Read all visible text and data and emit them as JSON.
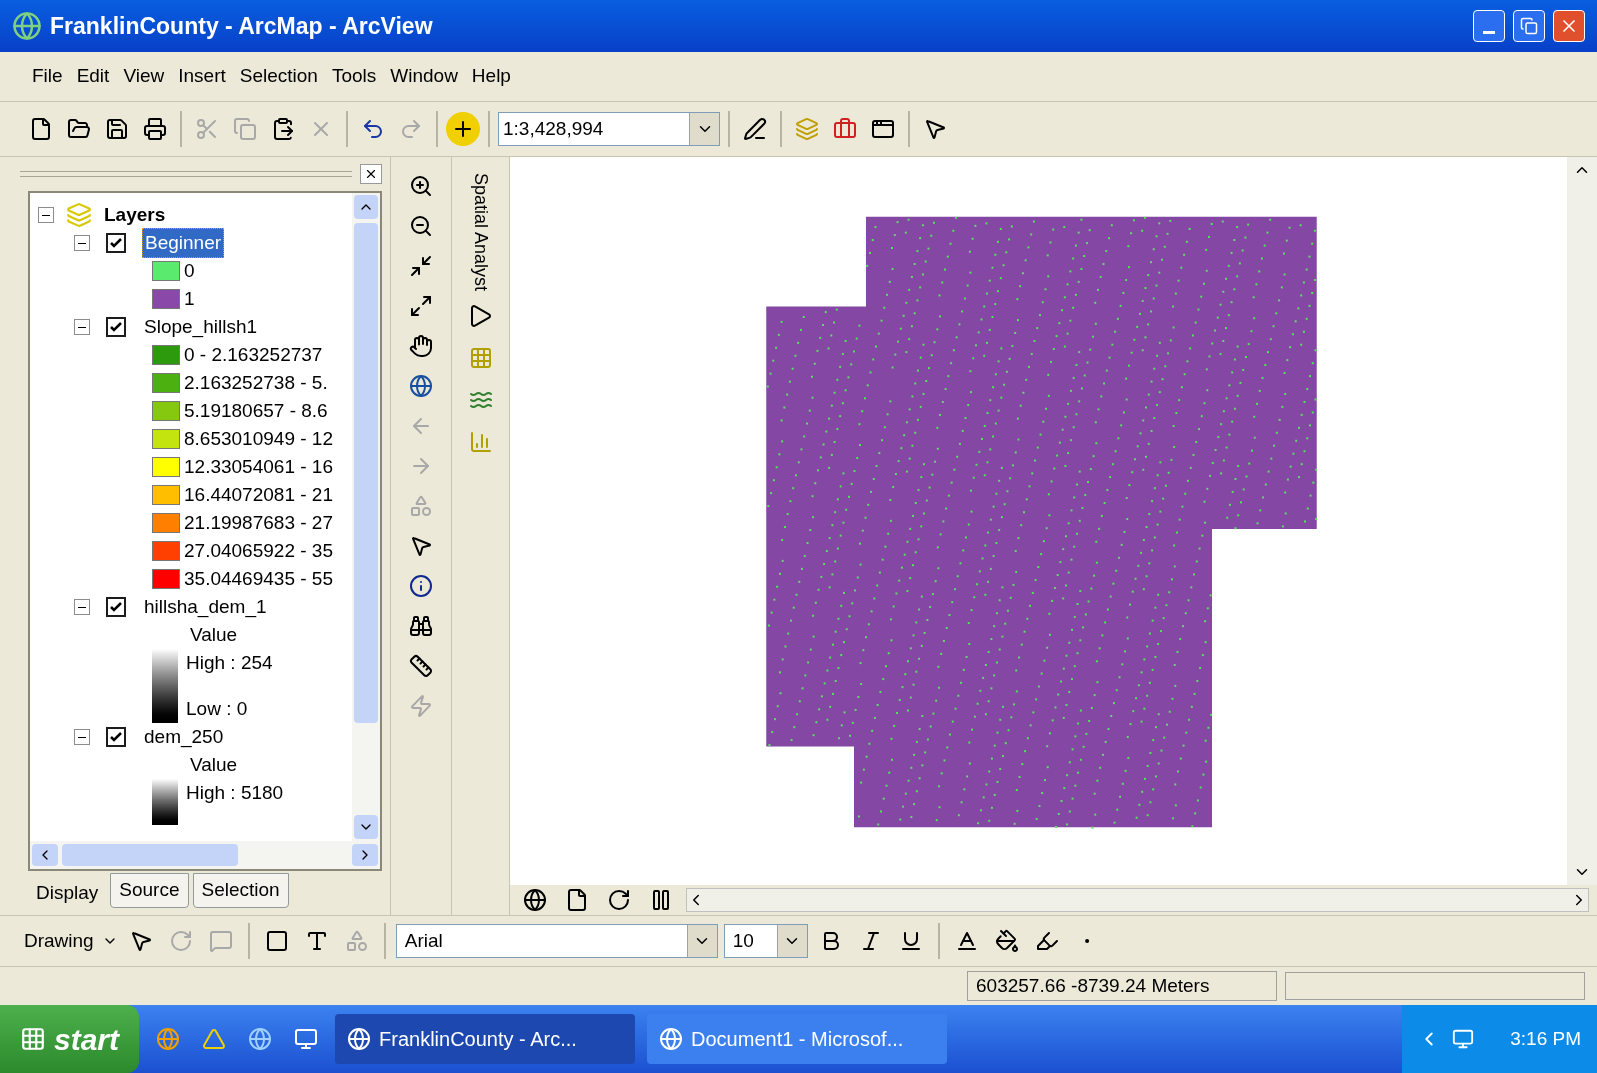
{
  "window": {
    "title": "FranklinCounty - ArcMap - ArcView"
  },
  "menu": [
    "File",
    "Edit",
    "View",
    "Insert",
    "Selection",
    "Tools",
    "Window",
    "Help"
  ],
  "toolbar": {
    "scale": "1:3,428,994"
  },
  "toc": {
    "root": "Layers",
    "layers": [
      {
        "name": "Beginner",
        "checked": true,
        "selected": true,
        "legend": [
          {
            "kind": "swatch",
            "label": "0",
            "color": "#5aea6e"
          },
          {
            "kind": "swatch",
            "label": "1",
            "color": "#8a48a8"
          }
        ]
      },
      {
        "name": "Slope_hillsh1",
        "checked": true,
        "selected": false,
        "legend": [
          {
            "kind": "swatch",
            "label": "0 - 2.163252737",
            "color": "#2c9a0c"
          },
          {
            "kind": "swatch",
            "label": "2.163252738 - 5.",
            "color": "#4cb010"
          },
          {
            "kind": "swatch",
            "label": "5.19180657 - 8.6",
            "color": "#86c810"
          },
          {
            "kind": "swatch",
            "label": "8.653010949 - 12",
            "color": "#c4e410"
          },
          {
            "kind": "swatch",
            "label": "12.33054061 - 16",
            "color": "#ffff00"
          },
          {
            "kind": "swatch",
            "label": "16.44072081 - 21",
            "color": "#ffbf00"
          },
          {
            "kind": "swatch",
            "label": "21.19987683 - 27",
            "color": "#ff8000"
          },
          {
            "kind": "swatch",
            "label": "27.04065922 - 35",
            "color": "#ff4000"
          },
          {
            "kind": "swatch",
            "label": "35.04469435 - 55",
            "color": "#ff0000"
          }
        ]
      },
      {
        "name": "hillsha_dem_1",
        "checked": true,
        "selected": false,
        "legend": [
          {
            "kind": "ramp",
            "heading": "Value",
            "high": "High : 254",
            "low": "Low : 0"
          }
        ]
      },
      {
        "name": "dem_250",
        "checked": true,
        "selected": false,
        "legend": [
          {
            "kind": "ramp",
            "heading": "Value",
            "high": "High : 5180"
          }
        ]
      }
    ]
  },
  "toc_tabs": [
    {
      "label": "Display",
      "selected": true
    },
    {
      "label": "Source",
      "selected": false
    },
    {
      "label": "Selection",
      "selected": false
    }
  ],
  "spatial_analyst": {
    "title": "Spatial Analyst"
  },
  "drawing_toolbar": {
    "menu": "Drawing",
    "font": "Arial",
    "size": "10"
  },
  "status_bar": {
    "coordinates": "603257.66  -8739.24 Meters"
  },
  "taskbar": {
    "start": "start",
    "tasks": [
      {
        "label": "FranklinCounty - Arc...",
        "selected": true
      },
      {
        "label": "Document1 - Microsof...",
        "selected": false
      }
    ],
    "clock": "3:16 PM"
  }
}
